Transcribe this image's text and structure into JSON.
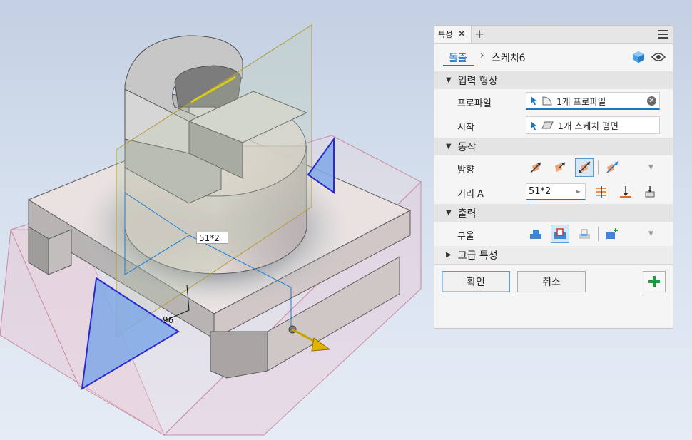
{
  "viewport": {
    "dimension_label": "51*2",
    "dimension_small": "96"
  },
  "panel": {
    "tab_label": "특성",
    "tab_close": "✕",
    "tab_add": "+",
    "breadcrumb": {
      "parent": "돌출",
      "separator": "›",
      "current": "스케치6"
    },
    "sections": {
      "input_geometry": "입력 형상",
      "behavior": "동작",
      "output": "출력",
      "advanced": "고급 특성"
    },
    "profile": {
      "label": "프로파일",
      "value": "1개 프로파일"
    },
    "start": {
      "label": "시작",
      "value": "1개 스케치 평면"
    },
    "direction": {
      "label": "방향"
    },
    "distance": {
      "label": "거리 A",
      "value": "51*2"
    },
    "boolean": {
      "label": "부울"
    },
    "buttons": {
      "ok": "확인",
      "cancel": "취소"
    },
    "icons": [
      "cube-icon",
      "eye-icon",
      "cursor-icon",
      "profile-icon",
      "plane-icon",
      "clear-icon",
      "direction-default-icon",
      "direction-flip-icon",
      "direction-symmetric-icon",
      "direction-asymmetric-icon",
      "between-icon",
      "to-icon",
      "to-next-icon",
      "join-icon",
      "cut-icon",
      "intersect-icon",
      "new-solid-icon",
      "add-plus-icon"
    ]
  },
  "colors": {
    "accent": "#1a76c8",
    "active_border": "#5b9bd5",
    "plus": "#1f9a3a"
  }
}
